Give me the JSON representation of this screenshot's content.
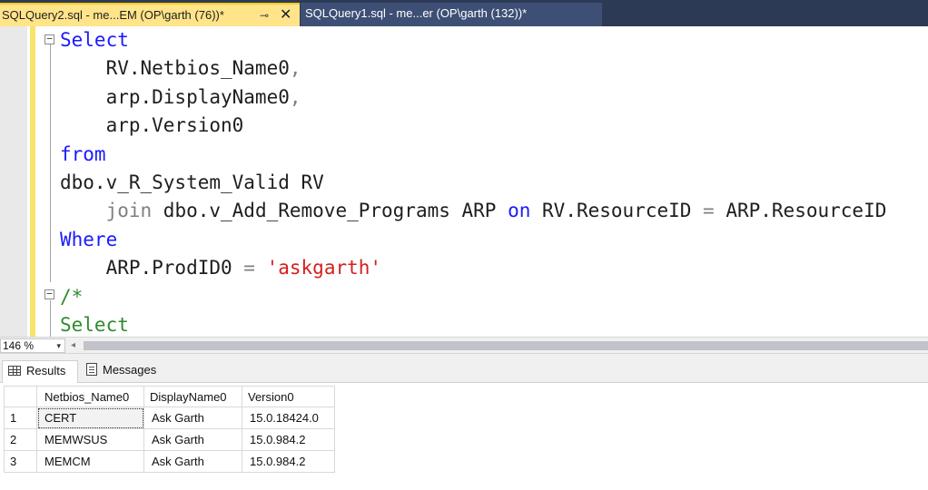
{
  "tabs": {
    "active_label": "SQLQuery2.sql - me...EM (OP\\garth (76))*",
    "pin_glyph": "⊸",
    "close_glyph": "✕",
    "inactive_label": "SQLQuery1.sql - me...er (OP\\garth (132))*"
  },
  "editor": {
    "fold_minus": "−",
    "lines": [
      [
        {
          "t": "Select",
          "c": "kw"
        }
      ],
      [
        {
          "t": "    RV.Netbios_Name0",
          "c": ""
        },
        {
          "t": ",",
          "c": "op"
        }
      ],
      [
        {
          "t": "    arp.DisplayName0",
          "c": ""
        },
        {
          "t": ",",
          "c": "op"
        }
      ],
      [
        {
          "t": "    arp.Version0",
          "c": ""
        }
      ],
      [
        {
          "t": "from",
          "c": "kw"
        }
      ],
      [
        {
          "t": "dbo.v_R_System_Valid RV",
          "c": ""
        }
      ],
      [
        {
          "t": "    join",
          "c": "kw-gray"
        },
        {
          "t": " dbo.v_Add_Remove_Programs ARP ",
          "c": ""
        },
        {
          "t": "on",
          "c": "kw"
        },
        {
          "t": " RV.ResourceID ",
          "c": ""
        },
        {
          "t": "=",
          "c": "op"
        },
        {
          "t": " ARP.ResourceID",
          "c": ""
        }
      ],
      [
        {
          "t": "Where",
          "c": "kw"
        }
      ],
      [
        {
          "t": "    ARP.ProdID0 ",
          "c": ""
        },
        {
          "t": "=",
          "c": "op"
        },
        {
          "t": " ",
          "c": ""
        },
        {
          "t": "'askgarth'",
          "c": "str"
        }
      ],
      [
        {
          "t": "/*",
          "c": "cm"
        }
      ],
      [
        {
          "t": "Select",
          "c": "cm"
        }
      ]
    ]
  },
  "zoom": {
    "value": "146 %",
    "arrow_glyph": "▾",
    "scroll_left_glyph": "◂"
  },
  "results_tabs": {
    "results_label": "Results",
    "messages_label": "Messages"
  },
  "grid": {
    "columns": [
      "Netbios_Name0",
      "DisplayName0",
      "Version0"
    ],
    "rows": [
      {
        "num": "1",
        "cells": [
          "CERT",
          "Ask Garth",
          "15.0.18424.0"
        ]
      },
      {
        "num": "2",
        "cells": [
          "MEMWSUS",
          "Ask Garth",
          "15.0.984.2"
        ]
      },
      {
        "num": "3",
        "cells": [
          "MEMCM",
          "Ask Garth",
          "15.0.984.2"
        ]
      }
    ],
    "selected_cell": {
      "row": 0,
      "col": 0
    }
  }
}
